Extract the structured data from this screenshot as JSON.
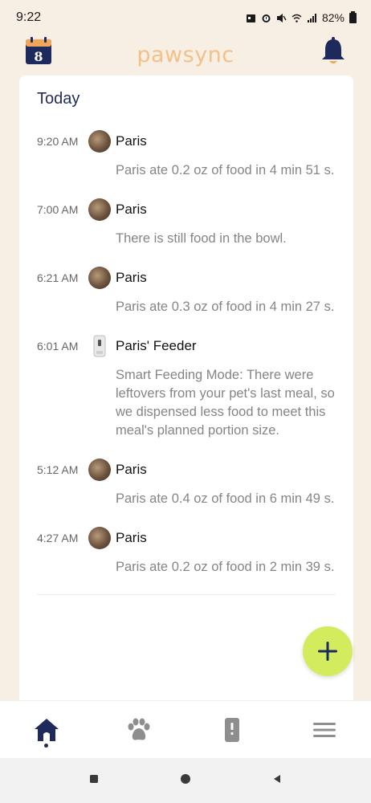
{
  "status_bar": {
    "time": "9:22",
    "battery": "82%"
  },
  "header": {
    "logo": "pawsync",
    "calendar_day": "8"
  },
  "today": {
    "title": "Today",
    "entries": [
      {
        "time": "9:20 AM",
        "name": "Paris",
        "icon": "pet-avatar",
        "message": "Paris ate 0.2 oz of food in 4 min 51 s."
      },
      {
        "time": "7:00 AM",
        "name": "Paris",
        "icon": "pet-avatar",
        "message": "There is still food in the bowl."
      },
      {
        "time": "6:21 AM",
        "name": "Paris",
        "icon": "pet-avatar",
        "message": "Paris ate 0.3 oz of food in 4 min 27 s."
      },
      {
        "time": "6:01 AM",
        "name": "Paris' Feeder",
        "icon": "feeder-icon",
        "message": "Smart Feeding Mode: There were leftovers from your pet's last meal, so we dispensed less food to meet this meal's planned portion size."
      },
      {
        "time": "5:12 AM",
        "name": "Paris",
        "icon": "pet-avatar",
        "message": "Paris ate 0.4 oz of food in 6 min 49 s."
      },
      {
        "time": "4:27 AM",
        "name": "Paris",
        "icon": "pet-avatar",
        "message": "Paris ate 0.2 oz of food in 2 min 39 s."
      }
    ]
  },
  "colors": {
    "navy": "#1f2a5c",
    "logo": "#f2c08a",
    "fab": "#d3ec5d",
    "background": "#f8efe4"
  },
  "bottom_nav": [
    "home-icon",
    "paw-icon",
    "feeder-device-icon",
    "menu-icon"
  ]
}
